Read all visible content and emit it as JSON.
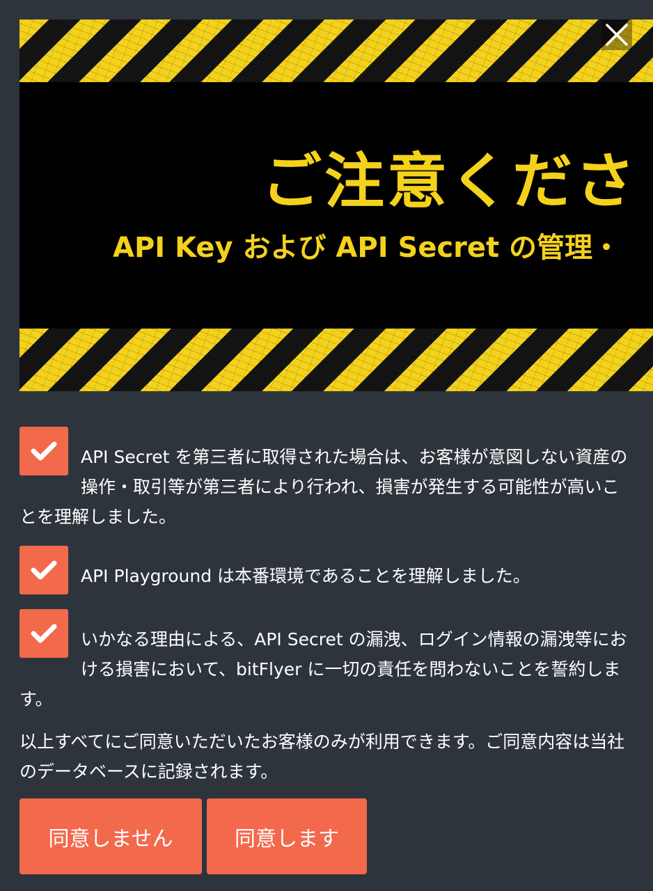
{
  "banner": {
    "title": "ご注意くださ",
    "subtitle": "API Key および API Secret の管理・"
  },
  "checklist": [
    {
      "checked": true,
      "text": "API Secret を第三者に取得された場合は、お客様が意図しない資産の操作・取引等が第三者により行われ、損害が発生する可能性が高いことを理解しました。"
    },
    {
      "checked": true,
      "text": "API Playground は本番環境であることを理解しました。"
    },
    {
      "checked": true,
      "text": "いかなる理由による、API Secret の漏洩、ログイン情報の漏洩等における損害において、bitFlyer に一切の責任を問わないことを誓約します。"
    }
  ],
  "notice": "以上すべてにご同意いただいたお客様のみが利用できます。ご同意内容は当社のデータベースに記録されます。",
  "buttons": {
    "decline": "同意しません",
    "agree": "同意します"
  },
  "icons": {
    "close": "close-icon",
    "check": "checkmark-icon"
  },
  "colors": {
    "background": "#2e343c",
    "accent": "#f2694c",
    "warning_yellow": "#f4d21c"
  }
}
